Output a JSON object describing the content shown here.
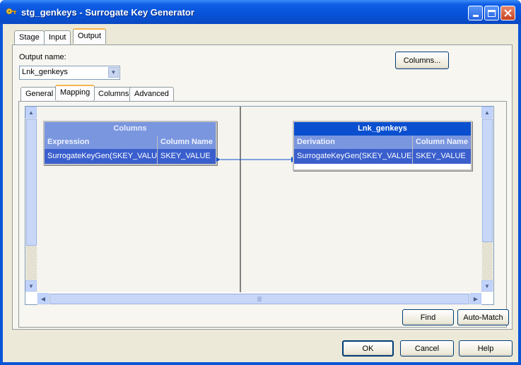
{
  "window": {
    "title": "stg_genkeys - Surrogate Key Generator"
  },
  "top_tabs": [
    "Stage",
    "Input",
    "Output"
  ],
  "output": {
    "name_label": "Output name:",
    "name_value": "Lnk_genkeys",
    "columns_button": "Columns..."
  },
  "sub_tabs": [
    "General",
    "Mapping",
    "Columns",
    "Advanced"
  ],
  "left_grid": {
    "title": "Columns",
    "headers": [
      "Expression",
      "Column Name"
    ],
    "rows": [
      [
        "SurrogateKeyGen(SKEY_VALUE",
        "SKEY_VALUE"
      ]
    ]
  },
  "right_grid": {
    "title": "Lnk_genkeys",
    "headers": [
      "Derivation",
      "Column Name"
    ],
    "rows": [
      [
        "SurrogateKeyGen(SKEY_VALUE)",
        "SKEY_VALUE"
      ]
    ]
  },
  "mapping_buttons": {
    "find": "Find",
    "auto_match": "Auto-Match"
  },
  "dialog_buttons": {
    "ok": "OK",
    "cancel": "Cancel",
    "help": "Help"
  },
  "icons": {
    "app": "key-generator-icon",
    "minimize": "minimize-icon",
    "maximize": "maximize-icon",
    "close": "close-icon"
  },
  "colors": {
    "title_bar": "#0752d8",
    "selected_row": "#3a5fcd",
    "active_grid_title": "#0a4fcf",
    "link_line": "#0a4fcf"
  }
}
